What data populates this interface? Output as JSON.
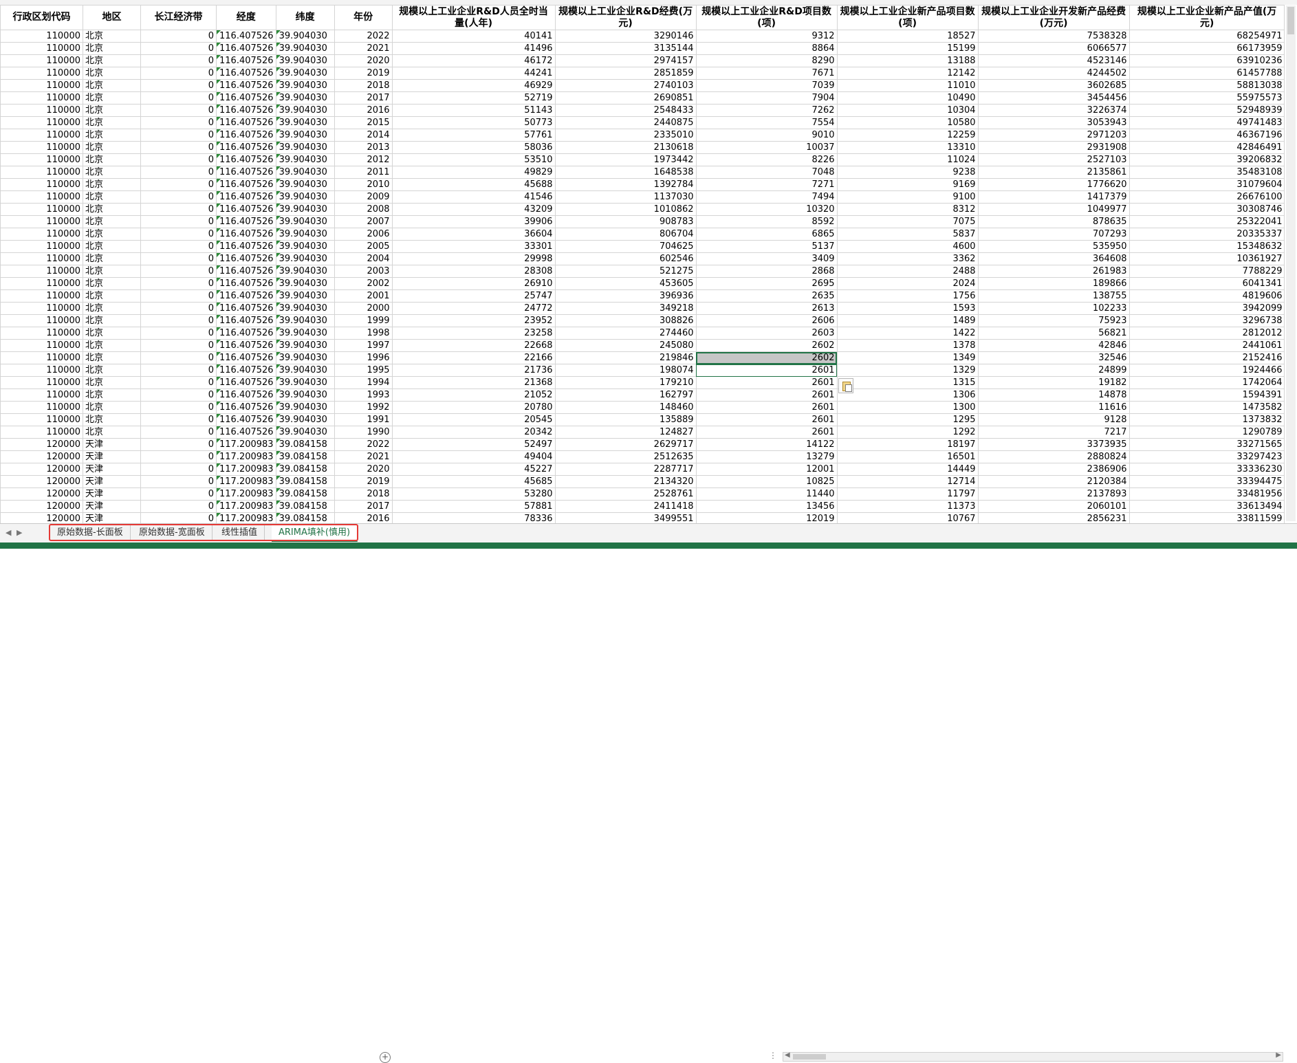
{
  "sheet": {
    "headers": [
      "行政区划代码",
      "地区",
      "长江经济带",
      "经度",
      "纬度",
      "年份",
      "规模以上工业企业R&D人员全时当量(人年)",
      "规模以上工业企业R&D经费(万元)",
      "规模以上工业企业R&D项目数(项)",
      "规模以上工业企业新产品项目数(项)",
      "规模以上工业企业开发新产品经费(万元)",
      "规模以上工业企业新产品产值(万元)"
    ],
    "rows": [
      [
        "110000",
        "北京",
        "0",
        "116.407526",
        "39.904030",
        "2022",
        "40141",
        "3290146",
        "9312",
        "18527",
        "7538328",
        "68254971"
      ],
      [
        "110000",
        "北京",
        "0",
        "116.407526",
        "39.904030",
        "2021",
        "41496",
        "3135144",
        "8864",
        "15199",
        "6066577",
        "66173959"
      ],
      [
        "110000",
        "北京",
        "0",
        "116.407526",
        "39.904030",
        "2020",
        "46172",
        "2974157",
        "8290",
        "13188",
        "4523146",
        "63910236"
      ],
      [
        "110000",
        "北京",
        "0",
        "116.407526",
        "39.904030",
        "2019",
        "44241",
        "2851859",
        "7671",
        "12142",
        "4244502",
        "61457788"
      ],
      [
        "110000",
        "北京",
        "0",
        "116.407526",
        "39.904030",
        "2018",
        "46929",
        "2740103",
        "7039",
        "11010",
        "3602685",
        "58813038"
      ],
      [
        "110000",
        "北京",
        "0",
        "116.407526",
        "39.904030",
        "2017",
        "52719",
        "2690851",
        "7904",
        "10490",
        "3454456",
        "55975573"
      ],
      [
        "110000",
        "北京",
        "0",
        "116.407526",
        "39.904030",
        "2016",
        "51143",
        "2548433",
        "7262",
        "10304",
        "3226374",
        "52948939"
      ],
      [
        "110000",
        "北京",
        "0",
        "116.407526",
        "39.904030",
        "2015",
        "50773",
        "2440875",
        "7554",
        "10580",
        "3053943",
        "49741483"
      ],
      [
        "110000",
        "北京",
        "0",
        "116.407526",
        "39.904030",
        "2014",
        "57761",
        "2335010",
        "9010",
        "12259",
        "2971203",
        "46367196"
      ],
      [
        "110000",
        "北京",
        "0",
        "116.407526",
        "39.904030",
        "2013",
        "58036",
        "2130618",
        "10037",
        "13310",
        "2931908",
        "42846491"
      ],
      [
        "110000",
        "北京",
        "0",
        "116.407526",
        "39.904030",
        "2012",
        "53510",
        "1973442",
        "8226",
        "11024",
        "2527103",
        "39206832"
      ],
      [
        "110000",
        "北京",
        "0",
        "116.407526",
        "39.904030",
        "2011",
        "49829",
        "1648538",
        "7048",
        "9238",
        "2135861",
        "35483108"
      ],
      [
        "110000",
        "北京",
        "0",
        "116.407526",
        "39.904030",
        "2010",
        "45688",
        "1392784",
        "7271",
        "9169",
        "1776620",
        "31079604"
      ],
      [
        "110000",
        "北京",
        "0",
        "116.407526",
        "39.904030",
        "2009",
        "41546",
        "1137030",
        "7494",
        "9100",
        "1417379",
        "26676100"
      ],
      [
        "110000",
        "北京",
        "0",
        "116.407526",
        "39.904030",
        "2008",
        "43209",
        "1010862",
        "10320",
        "8312",
        "1049977",
        "30308746"
      ],
      [
        "110000",
        "北京",
        "0",
        "116.407526",
        "39.904030",
        "2007",
        "39906",
        "908783",
        "8592",
        "7075",
        "878635",
        "25322041"
      ],
      [
        "110000",
        "北京",
        "0",
        "116.407526",
        "39.904030",
        "2006",
        "36604",
        "806704",
        "6865",
        "5837",
        "707293",
        "20335337"
      ],
      [
        "110000",
        "北京",
        "0",
        "116.407526",
        "39.904030",
        "2005",
        "33301",
        "704625",
        "5137",
        "4600",
        "535950",
        "15348632"
      ],
      [
        "110000",
        "北京",
        "0",
        "116.407526",
        "39.904030",
        "2004",
        "29998",
        "602546",
        "3409",
        "3362",
        "364608",
        "10361927"
      ],
      [
        "110000",
        "北京",
        "0",
        "116.407526",
        "39.904030",
        "2003",
        "28308",
        "521275",
        "2868",
        "2488",
        "261983",
        "7788229"
      ],
      [
        "110000",
        "北京",
        "0",
        "116.407526",
        "39.904030",
        "2002",
        "26910",
        "453605",
        "2695",
        "2024",
        "189866",
        "6041341"
      ],
      [
        "110000",
        "北京",
        "0",
        "116.407526",
        "39.904030",
        "2001",
        "25747",
        "396936",
        "2635",
        "1756",
        "138755",
        "4819606"
      ],
      [
        "110000",
        "北京",
        "0",
        "116.407526",
        "39.904030",
        "2000",
        "24772",
        "349218",
        "2613",
        "1593",
        "102233",
        "3942099"
      ],
      [
        "110000",
        "北京",
        "0",
        "116.407526",
        "39.904030",
        "1999",
        "23952",
        "308826",
        "2606",
        "1489",
        "75923",
        "3296738"
      ],
      [
        "110000",
        "北京",
        "0",
        "116.407526",
        "39.904030",
        "1998",
        "23258",
        "274460",
        "2603",
        "1422",
        "56821",
        "2812012"
      ],
      [
        "110000",
        "北京",
        "0",
        "116.407526",
        "39.904030",
        "1997",
        "22668",
        "245080",
        "2602",
        "1378",
        "42846",
        "2441061"
      ],
      [
        "110000",
        "北京",
        "0",
        "116.407526",
        "39.904030",
        "1996",
        "22166",
        "219846",
        "2602",
        "1349",
        "32546",
        "2152416"
      ],
      [
        "110000",
        "北京",
        "0",
        "116.407526",
        "39.904030",
        "1995",
        "21736",
        "198074",
        "2601",
        "1329",
        "24899",
        "1924466"
      ],
      [
        "110000",
        "北京",
        "0",
        "116.407526",
        "39.904030",
        "1994",
        "21368",
        "179210",
        "2601",
        "1315",
        "19182",
        "1742064"
      ],
      [
        "110000",
        "北京",
        "0",
        "116.407526",
        "39.904030",
        "1993",
        "21052",
        "162797",
        "2601",
        "1306",
        "14878",
        "1594391"
      ],
      [
        "110000",
        "北京",
        "0",
        "116.407526",
        "39.904030",
        "1992",
        "20780",
        "148460",
        "2601",
        "1300",
        "11616",
        "1473582"
      ],
      [
        "110000",
        "北京",
        "0",
        "116.407526",
        "39.904030",
        "1991",
        "20545",
        "135889",
        "2601",
        "1295",
        "9128",
        "1373832"
      ],
      [
        "110000",
        "北京",
        "0",
        "116.407526",
        "39.904030",
        "1990",
        "20342",
        "124827",
        "2601",
        "1292",
        "7217",
        "1290789"
      ],
      [
        "120000",
        "天津",
        "0",
        "117.200983",
        "39.084158",
        "2022",
        "52497",
        "2629717",
        "14122",
        "18197",
        "3373935",
        "33271565"
      ],
      [
        "120000",
        "天津",
        "0",
        "117.200983",
        "39.084158",
        "2021",
        "49404",
        "2512635",
        "13279",
        "16501",
        "2880824",
        "33297423"
      ],
      [
        "120000",
        "天津",
        "0",
        "117.200983",
        "39.084158",
        "2020",
        "45227",
        "2287717",
        "12001",
        "14449",
        "2386906",
        "33336230"
      ],
      [
        "120000",
        "天津",
        "0",
        "117.200983",
        "39.084158",
        "2019",
        "45685",
        "2134320",
        "10825",
        "12714",
        "2120384",
        "33394475"
      ],
      [
        "120000",
        "天津",
        "0",
        "117.200983",
        "39.084158",
        "2018",
        "53280",
        "2528761",
        "11440",
        "11797",
        "2137893",
        "33481956"
      ],
      [
        "120000",
        "天津",
        "0",
        "117.200983",
        "39.084158",
        "2017",
        "57881",
        "2411418",
        "13456",
        "11373",
        "2060101",
        "33613494"
      ],
      [
        "120000",
        "天津",
        "0",
        "117.200983",
        "39.084158",
        "2016",
        "78336",
        "3499551",
        "12019",
        "10767",
        "2856231",
        "33811599"
      ]
    ]
  },
  "tabs": [
    "原始数据-长面板",
    "原始数据-宽面板",
    "线性插值",
    "ARIMA填补(慎用)"
  ],
  "active_tab_index": 3,
  "colors": {
    "accent": "#217346",
    "highlight": "#e53935",
    "selected_fill": "#c6c6c6"
  },
  "icons": {
    "paste_options": "paste-options-icon",
    "add_sheet": "add-sheet-icon"
  }
}
